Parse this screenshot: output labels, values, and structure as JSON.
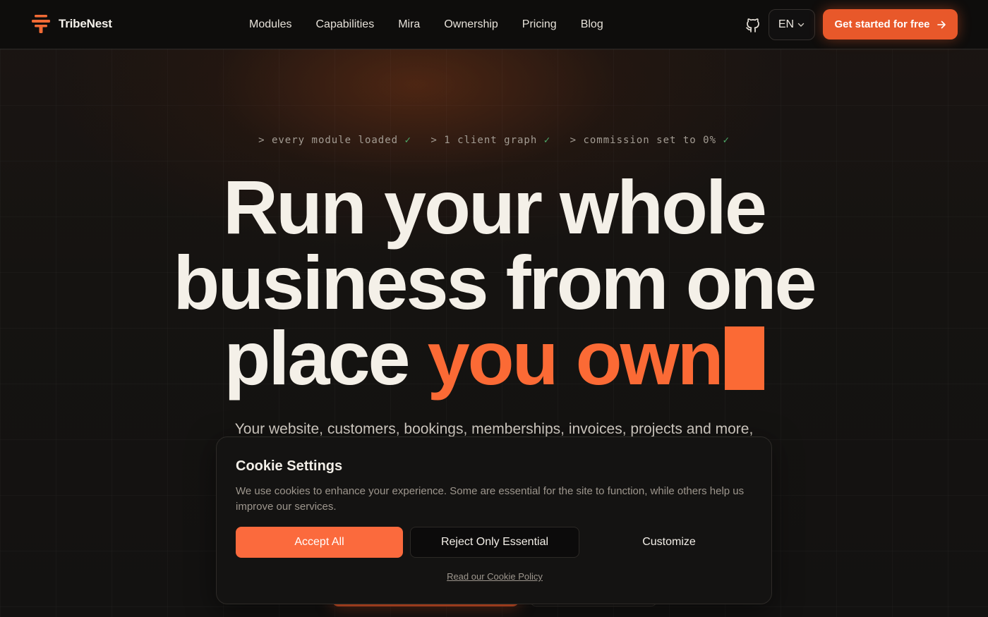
{
  "brand": {
    "name": "TribeNest",
    "icon": "tribenest-logo",
    "accent": "#e8582a"
  },
  "nav": {
    "items": [
      {
        "label": "Modules"
      },
      {
        "label": "Capabilities"
      },
      {
        "label": "Mira"
      },
      {
        "label": "Ownership"
      },
      {
        "label": "Pricing"
      },
      {
        "label": "Blog"
      }
    ],
    "github_icon": "github-icon",
    "language": "EN",
    "cta_label": "Get started for free"
  },
  "hero": {
    "terminal": [
      {
        "text": "> every module loaded",
        "check": "✓"
      },
      {
        "text": "> 1 client graph",
        "check": "✓"
      },
      {
        "text": "> commission set to 0%",
        "check": "✓"
      }
    ],
    "headline_line1": "Run your whole",
    "headline_line2": "business from one",
    "headline_line3_plain": "place ",
    "headline_line3_accent": "you own",
    "subtitle": "Your website, customers, bookings, memberships, invoices, projects and more,"
  },
  "cookie": {
    "title": "Cookie Settings",
    "description": "We use cookies to enhance your experience. Some are essential for the site to function, while others help us improve our services.",
    "accept_label": "Accept All",
    "reject_label": "Reject Only Essential",
    "customize_label": "Customize",
    "policy_link": "Read our Cookie Policy"
  }
}
